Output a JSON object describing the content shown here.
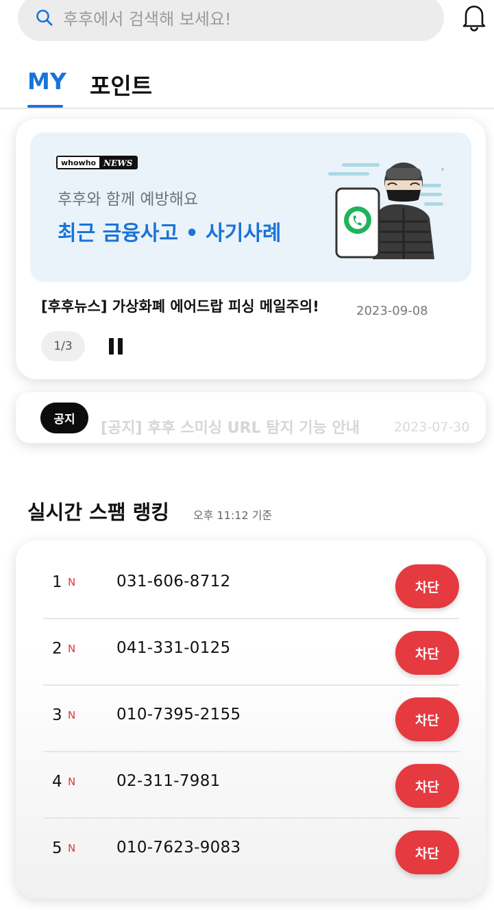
{
  "search": {
    "placeholder": "후후에서 검색해 보세요!"
  },
  "tabs": [
    {
      "label": "MY"
    },
    {
      "label": "포인트"
    }
  ],
  "news": {
    "logo_left": "whowho",
    "logo_right": "NEWS",
    "banner_subtitle": "후후와 함께 예방해요",
    "banner_title": "최근 금융사고 • 사기사례",
    "headline": "[후후뉴스] 가상화폐 에어드랍 피싱 메일주의!",
    "date": "2023-09-08",
    "pager": "1/3"
  },
  "notice": {
    "badge": "공지",
    "text": "[공지] 후후 스미싱 URL 탐지 기능 안내",
    "date": "2023-07-30"
  },
  "ranking": {
    "title": "실시간 스팸 랭킹",
    "time": "오후 11:12 기준",
    "rows": [
      {
        "rank": "1",
        "badge": "N",
        "phone": "031-606-8712",
        "button": "차단"
      },
      {
        "rank": "2",
        "badge": "N",
        "phone": "041-331-0125",
        "button": "차단"
      },
      {
        "rank": "3",
        "badge": "N",
        "phone": "010-7395-2155",
        "button": "차단"
      },
      {
        "rank": "4",
        "badge": "N",
        "phone": "02-311-7981",
        "button": "차단"
      },
      {
        "rank": "5",
        "badge": "N",
        "phone": "010-7623-9083",
        "button": "차단"
      }
    ]
  },
  "colors": {
    "accent": "#1a73d9",
    "block": "#e53a40",
    "new_badge": "#e0323a"
  },
  "icons": [
    "search-icon",
    "bell-icon",
    "pause-icon",
    "phone-icon"
  ]
}
